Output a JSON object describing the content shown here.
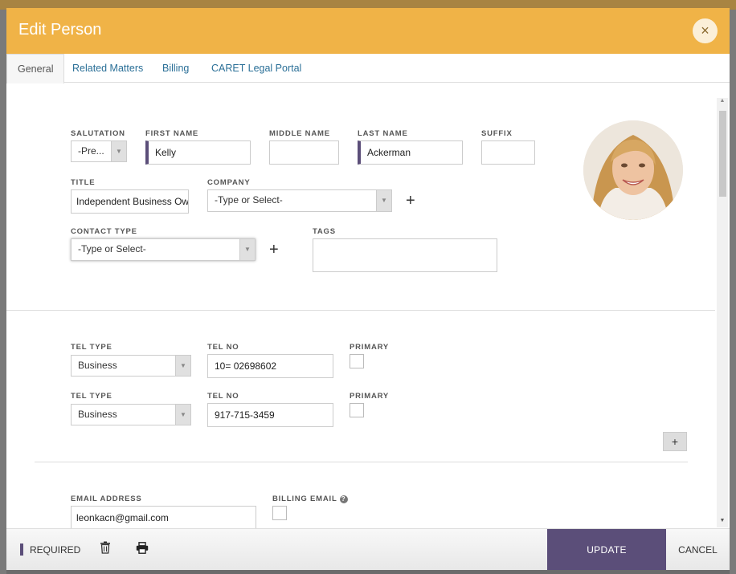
{
  "dialog": {
    "title": "Edit Person",
    "close_glyph": "×"
  },
  "tabs": [
    {
      "label": "General",
      "active": true
    },
    {
      "label": "Related Matters",
      "active": false
    },
    {
      "label": "Billing",
      "active": false
    },
    {
      "label": "CARET Legal Portal",
      "active": false
    }
  ],
  "person": {
    "salutation_label": "SALUTATION",
    "salutation_value": "-Pre...",
    "first_name_label": "FIRST NAME",
    "first_name_value": "Kelly",
    "middle_name_label": "MIDDLE NAME",
    "middle_name_value": "",
    "last_name_label": "LAST NAME",
    "last_name_value": "Ackerman",
    "suffix_label": "SUFFIX",
    "suffix_value": "",
    "title_label": "TITLE",
    "title_value": "Independent Business Owner",
    "company_label": "COMPANY",
    "company_value": "-Type or Select-",
    "contact_type_label": "CONTACT TYPE",
    "contact_type_value": "-Type or Select-",
    "tags_label": "TAGS",
    "tags_value": ""
  },
  "phones": [
    {
      "type_label": "TEL TYPE",
      "type_value": "Business",
      "no_label": "TEL NO",
      "no_value": "10= 02698602",
      "primary_label": "PRIMARY",
      "primary": false
    },
    {
      "type_label": "TEL TYPE",
      "type_value": "Business",
      "no_label": "TEL NO",
      "no_value": "917-715-3459",
      "primary_label": "PRIMARY",
      "primary": false
    }
  ],
  "email": {
    "label": "EMAIL ADDRESS",
    "value": "leonkacn@gmail.com",
    "billing_label": "BILLING EMAIL",
    "help_glyph": "?"
  },
  "footer": {
    "required_label": "REQUIRED",
    "update_label": "UPDATE",
    "cancel_label": "CANCEL"
  },
  "colors": {
    "header": "#f0b347",
    "accent": "#5b4e79",
    "link": "#2a6f97"
  },
  "icons": [
    "close-icon",
    "plus-icon",
    "trash-icon",
    "print-icon",
    "help-icon",
    "chevron-down-icon"
  ]
}
